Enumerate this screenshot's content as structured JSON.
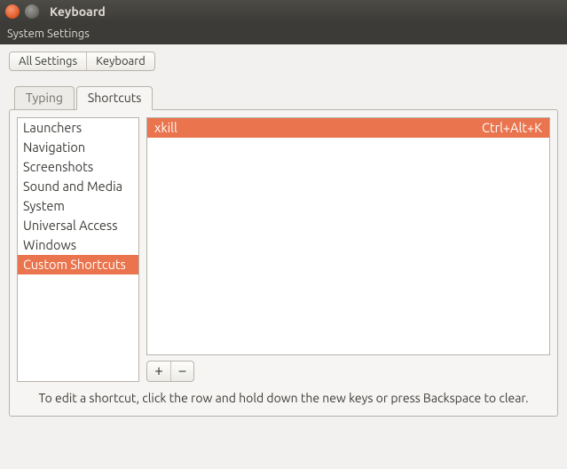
{
  "window": {
    "title": "Keyboard",
    "menu": "System Settings"
  },
  "breadcrumbs": {
    "all": "All Settings",
    "current": "Keyboard"
  },
  "tabs": {
    "typing": "Typing",
    "shortcuts": "Shortcuts"
  },
  "categories": [
    "Launchers",
    "Navigation",
    "Screenshots",
    "Sound and Media",
    "System",
    "Universal Access",
    "Windows",
    "Custom Shortcuts"
  ],
  "selected_category_index": 7,
  "shortcuts": [
    {
      "name": "xkill",
      "accel": "Ctrl+Alt+K",
      "selected": true
    }
  ],
  "buttons": {
    "add": "+",
    "remove": "−"
  },
  "hint": "To edit a shortcut, click the row and hold down the new keys or press Backspace to clear."
}
